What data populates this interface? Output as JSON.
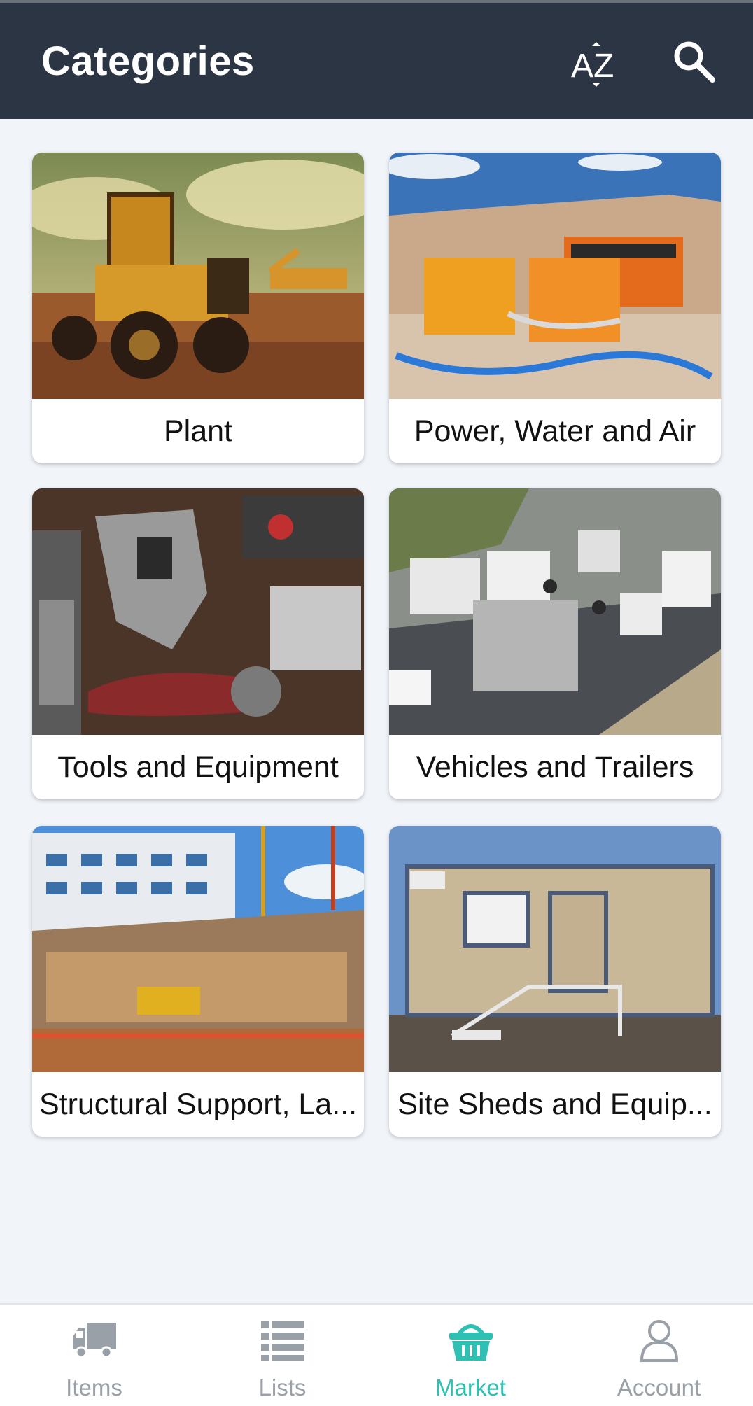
{
  "appbar": {
    "title": "Categories",
    "sort_icon": "az-sort-icon",
    "search_icon": "search-icon"
  },
  "categories": [
    {
      "label": "Plant",
      "image": "bulldozer-photo"
    },
    {
      "label": "Power, Water and Air",
      "image": "pumps-generators-photo"
    },
    {
      "label": "Tools and Equipment",
      "image": "power-tools-photo"
    },
    {
      "label": "Vehicles and Trailers",
      "image": "trucks-highway-photo"
    },
    {
      "label": "Structural Support, La...",
      "image": "construction-site-photo"
    },
    {
      "label": "Site Sheds and Equip...",
      "image": "site-shed-photo"
    }
  ],
  "bottom_nav": {
    "items": [
      {
        "label": "Items",
        "icon": "truck-icon",
        "active": false
      },
      {
        "label": "Lists",
        "icon": "list-icon",
        "active": false
      },
      {
        "label": "Market",
        "icon": "basket-icon",
        "active": true
      },
      {
        "label": "Account",
        "icon": "user-icon",
        "active": false
      }
    ]
  },
  "colors": {
    "appbar": "#2c3544",
    "background": "#f1f4f9",
    "accent": "#2fc0b4",
    "nav_inactive": "#9aa0a8"
  }
}
